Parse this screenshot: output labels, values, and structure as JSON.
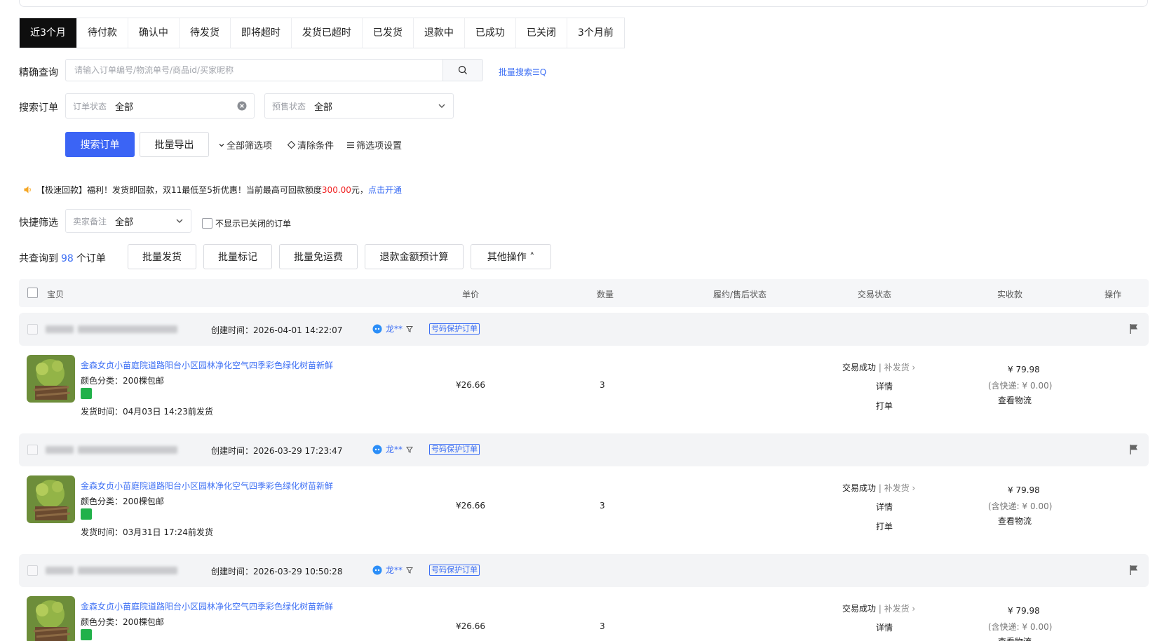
{
  "tabs": [
    "近3个月",
    "待付款",
    "确认中",
    "待发货",
    "即将超时",
    "发货已超时",
    "已发货",
    "退款中",
    "已成功",
    "已关闭",
    "3个月前"
  ],
  "precise": {
    "label": "精确查询",
    "placeholder": "请输入订单编号/物流单号/商品id/买家昵称",
    "batch_search": "批量搜索☰Q"
  },
  "search": {
    "label": "搜索订单",
    "order_status_label": "订单状态",
    "order_status_value": "全部",
    "presale_label": "预售状态",
    "presale_value": "全部",
    "search_btn": "搜索订单",
    "export_btn": "批量导出",
    "all_filters": "全部筛选项",
    "clear": "清除条件",
    "filter_settings": "筛选项设置"
  },
  "notice": {
    "prefix": "【极速回款】福利！发货即回款，双11最低至5折优惠！当前最高可回款额度",
    "amount": "300.00",
    "suffix": "元，",
    "link": "点击开通"
  },
  "quick": {
    "label": "快捷筛选",
    "remark_label": "卖家备注",
    "remark_value": "全部",
    "hide_closed": "不显示已关闭的订单"
  },
  "summary": {
    "prefix": "共查询到",
    "count": "98",
    "suffix": "个订单",
    "buttons": [
      "批量发货",
      "批量标记",
      "批量免运费",
      "退款金额预计算",
      "其他操作 ˄"
    ]
  },
  "table_headers": [
    "宝贝",
    "单价",
    "数量",
    "履约/售后状态",
    "交易状态",
    "实收款",
    "操作"
  ],
  "orders": [
    {
      "created": "创建时间：2026-04-01 14:22:07",
      "buyer": "龙**",
      "protect": "号码保护订单",
      "title": "金森女贞小苗庭院道路阳台小区园林净化空气四季彩色绿化树苗新鲜",
      "sku": "颜色分类：200棵包邮",
      "ship": "发货时间：04月03日 14:23前发货",
      "price": "¥26.66",
      "qty": "3",
      "status": "交易成功",
      "status_sub": "| 补发货 ›",
      "detail": "详情",
      "print": "打单",
      "paid": "¥ 79.98",
      "paid_note": "(含快递: ¥ 0.00)",
      "logistics": "查看物流"
    },
    {
      "created": "创建时间：2026-03-29 17:23:47",
      "buyer": "龙**",
      "protect": "号码保护订单",
      "title": "金森女贞小苗庭院道路阳台小区园林净化空气四季彩色绿化树苗新鲜",
      "sku": "颜色分类：200棵包邮",
      "ship": "发货时间：03月31日 17:24前发货",
      "price": "¥26.66",
      "qty": "3",
      "status": "交易成功",
      "status_sub": "| 补发货 ›",
      "detail": "详情",
      "print": "打单",
      "paid": "¥ 79.98",
      "paid_note": "(含快递: ¥ 0.00)",
      "logistics": "查看物流"
    },
    {
      "created": "创建时间：2026-03-29 10:50:28",
      "buyer": "龙**",
      "protect": "号码保护订单",
      "title": "金森女贞小苗庭院道路阳台小区园林净化空气四季彩色绿化树苗新鲜",
      "sku": "颜色分类：200棵包邮",
      "ship": "",
      "price": "¥26.66",
      "qty": "3",
      "status": "交易成功",
      "status_sub": "| 补发货 ›",
      "detail": "详情",
      "print": "",
      "paid": "¥ 79.98",
      "paid_note": "(含快递: ¥ 0.00)",
      "logistics": "查看物流"
    }
  ]
}
